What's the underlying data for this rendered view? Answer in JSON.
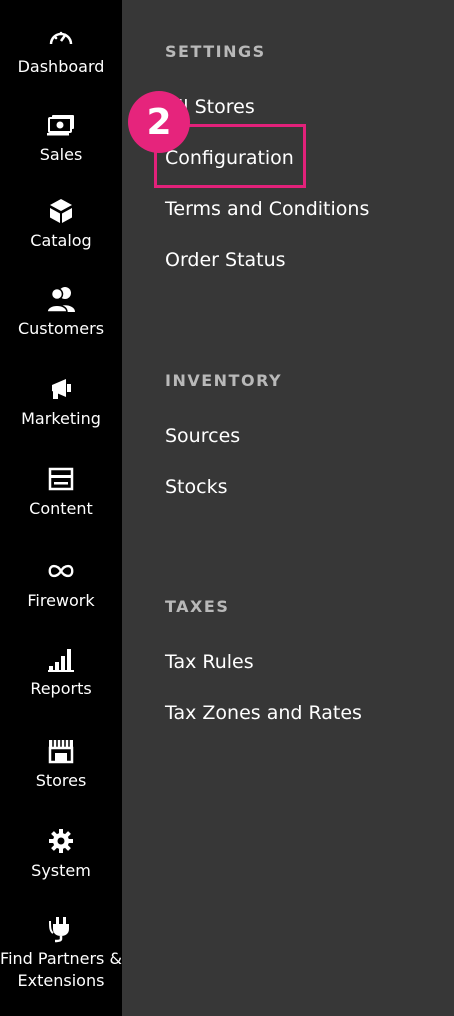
{
  "sidebar": {
    "items": [
      {
        "label": "Dashboard",
        "icon": "dashboard-icon"
      },
      {
        "label": "Sales",
        "icon": "sales-icon"
      },
      {
        "label": "Catalog",
        "icon": "catalog-icon"
      },
      {
        "label": "Customers",
        "icon": "customers-icon"
      },
      {
        "label": "Marketing",
        "icon": "marketing-icon"
      },
      {
        "label": "Content",
        "icon": "content-icon"
      },
      {
        "label": "Firework",
        "icon": "firework-icon"
      },
      {
        "label": "Reports",
        "icon": "reports-icon"
      },
      {
        "label": "Stores",
        "icon": "stores-icon"
      },
      {
        "label": "System",
        "icon": "system-icon"
      },
      {
        "label": "Find Partners & Extensions",
        "icon": "partners-icon"
      }
    ]
  },
  "panel": {
    "settings": {
      "title": "SETTINGS",
      "links": [
        "All Stores",
        "Configuration",
        "Terms and Conditions",
        "Order Status"
      ]
    },
    "inventory": {
      "title": "INVENTORY",
      "links": [
        "Sources",
        "Stocks"
      ]
    },
    "taxes": {
      "title": "TAXES",
      "links": [
        "Tax Rules",
        "Tax Zones and Rates"
      ]
    }
  },
  "annotation": {
    "step": "2",
    "highlight_color": "#e2217a"
  },
  "colors": {
    "sidebar_bg": "#000000",
    "panel_bg": "#373737",
    "section_title": "#b9b9b9"
  }
}
